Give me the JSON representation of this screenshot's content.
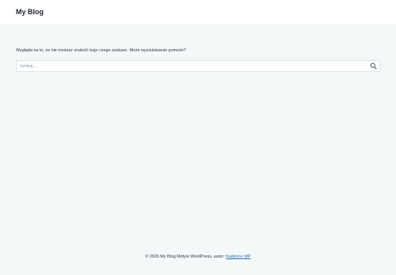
{
  "header": {
    "site_title": "My Blog"
  },
  "main": {
    "not_found_message": "Wygląda na to, że nie możesz znaleźć tego czego szukasz. Może wyszukiwanie pomoże?",
    "search": {
      "placeholder": "Szukaj ...",
      "value": "",
      "submit_icon": "search-icon"
    }
  },
  "footer": {
    "copyright_text": "© 2026 My Blog Motyw WordPress, autor: ",
    "theme_link_text": "Kadence WP"
  },
  "colors": {
    "page_background": "#f5f8f9",
    "header_background": "#ffffff",
    "link": "#2b6cb0"
  }
}
